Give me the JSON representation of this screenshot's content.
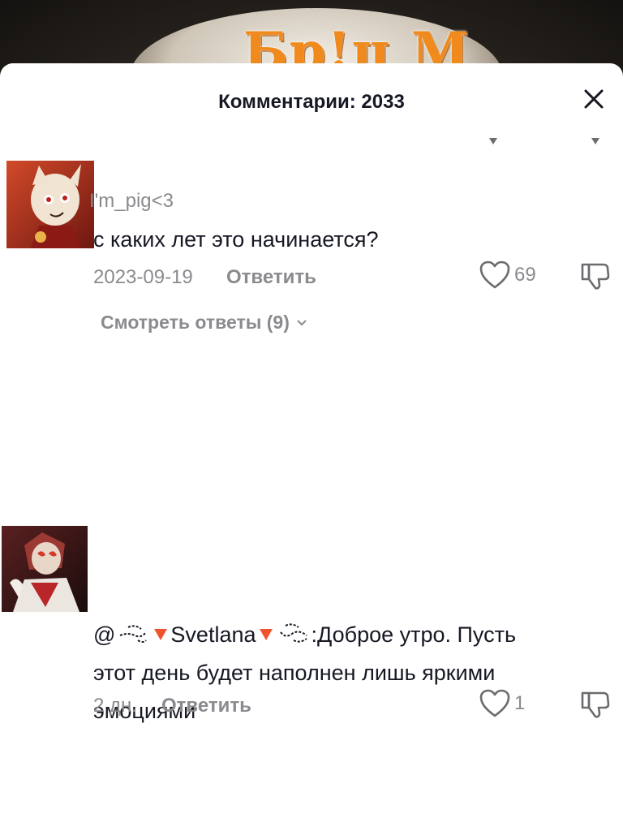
{
  "video": {
    "overlay_text": "Бр!ц М"
  },
  "sheet": {
    "title": "Комментарии: 2033"
  },
  "comments": [
    {
      "username": "I'm_pig<3",
      "text": "с каких лет это начинается?",
      "date": "2023-09-19",
      "reply_label": "Ответить",
      "likes": "69",
      "view_replies_label": "Смотреть ответы (9)"
    },
    {
      "username_prefix": "@",
      "username_name": "Svetlana",
      "text_after_mention": ":Доброе утро. Пусть",
      "text_line2": "этот день будет наполнен лишь яркими",
      "text_line3": "эмоциями",
      "date": "2 дн.",
      "reply_label": "Ответить",
      "likes": "1"
    }
  ],
  "colors": {
    "text_primary": "#161823",
    "text_secondary": "#8a8a8f",
    "accent_emoji": "#f0542d"
  },
  "icons": [
    "close-icon",
    "heart-icon",
    "dislike-icon",
    "chevron-down-icon"
  ]
}
